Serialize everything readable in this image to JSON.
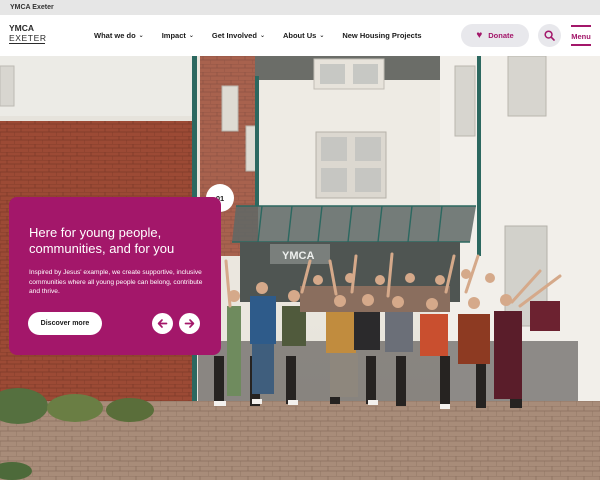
{
  "topbar": {
    "site_name": "YMCA Exeter"
  },
  "logo": {
    "line1": "YMCA",
    "line2": "EXETER"
  },
  "nav": {
    "items": [
      {
        "label": "What we do",
        "has_dropdown": true
      },
      {
        "label": "Impact",
        "has_dropdown": true
      },
      {
        "label": "Get Involved",
        "has_dropdown": true
      },
      {
        "label": "About Us",
        "has_dropdown": true
      },
      {
        "label": "New Housing Projects",
        "has_dropdown": false
      }
    ],
    "chevron": "⌄"
  },
  "actions": {
    "donate_label": "Donate",
    "donate_icon": "heart-icon",
    "search_icon": "search-icon",
    "menu_label": "Menu"
  },
  "hero": {
    "slide_number": "01",
    "title": "Here for young people, communities, and for you",
    "description": "Inspired by Jesus' example, we create supportive, inclusive communities where all young people can belong, contribute and thrive.",
    "cta_label": "Discover more",
    "prev_icon": "arrow-left-icon",
    "next_icon": "arrow-right-icon",
    "building_sign": "YMCA"
  },
  "colors": {
    "brand_magenta": "#a3176a",
    "header_bg": "#ffffff",
    "topbar_bg": "#e6e6e6"
  }
}
